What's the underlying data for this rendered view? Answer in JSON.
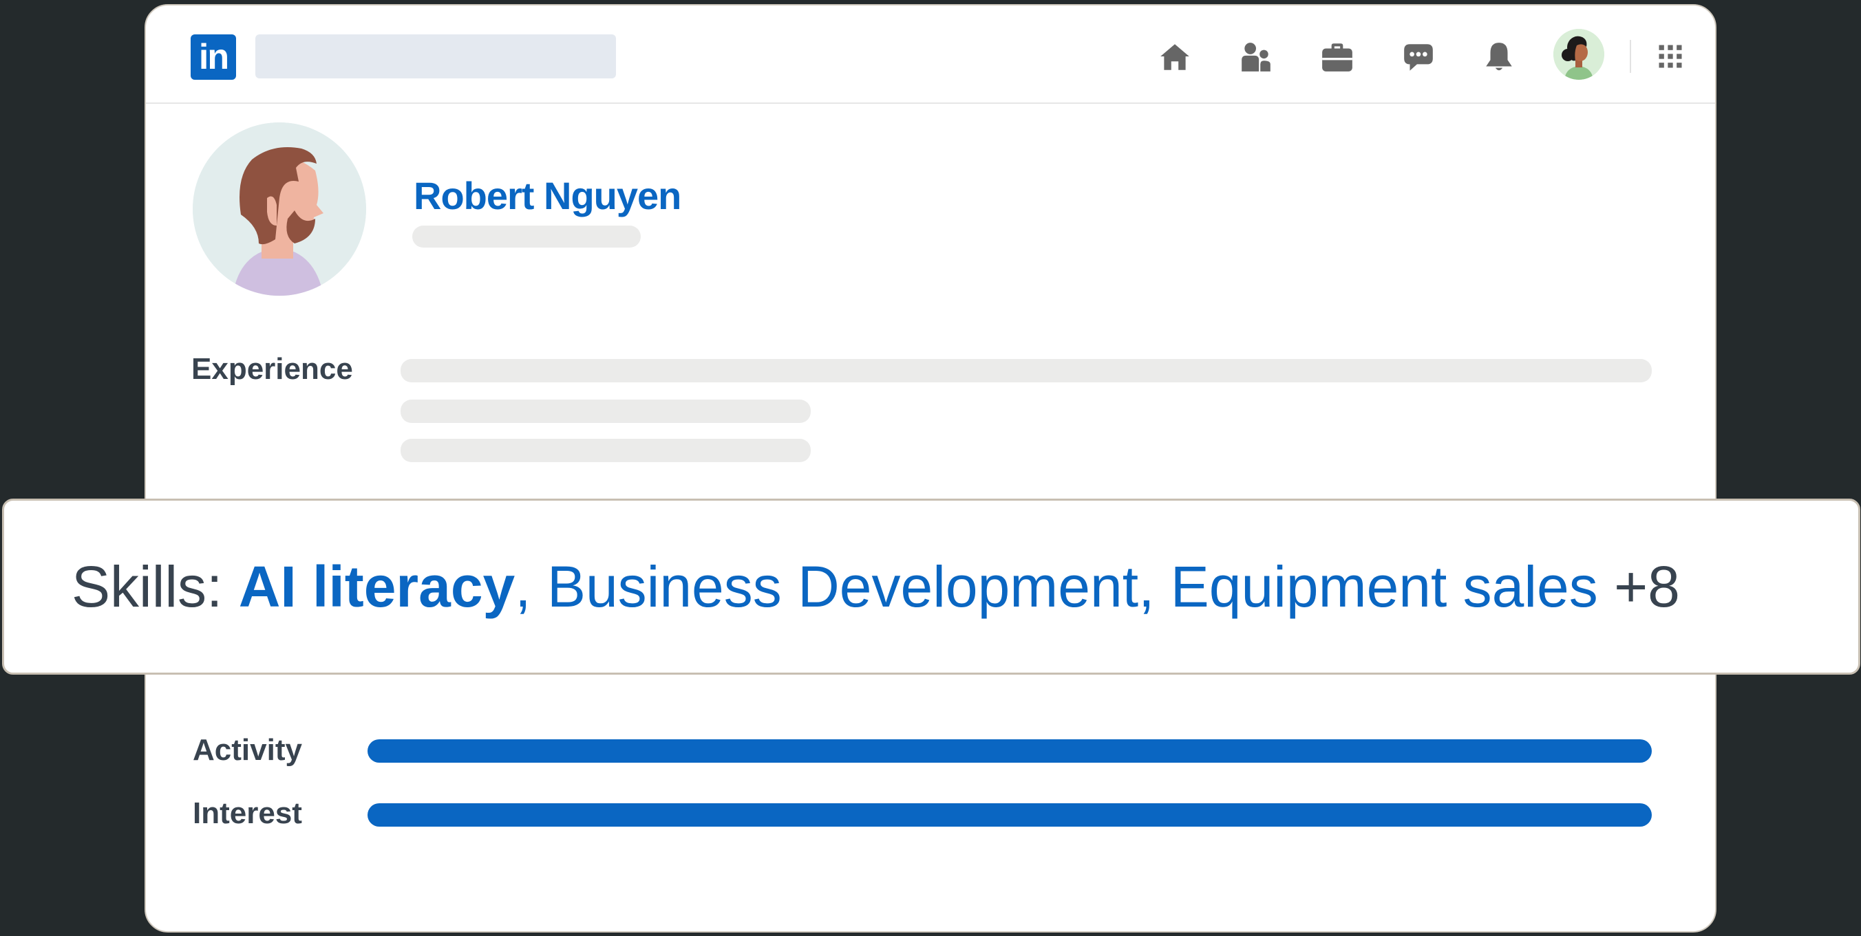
{
  "header": {
    "logo_text": "in",
    "nav_icons": [
      "home-icon",
      "my-network-icon",
      "jobs-icon",
      "messaging-icon",
      "notifications-icon"
    ],
    "brand_color": "#0a66c2"
  },
  "profile": {
    "name": "Robert Nguyen"
  },
  "sections": {
    "experience_label": "Experience",
    "activity_label": "Activity",
    "interest_label": "Interest"
  },
  "skills": {
    "prefix": "Skills:",
    "highlight": "AI literacy",
    "separator1": ",",
    "skill2": "Business Development",
    "separator2": ",",
    "skill3": "Equipment sales",
    "more": "+8"
  }
}
